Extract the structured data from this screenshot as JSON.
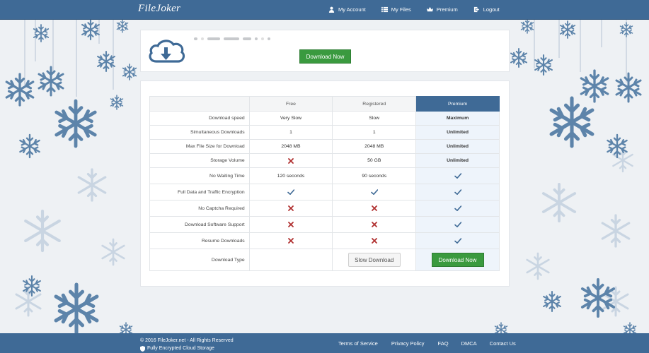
{
  "header": {
    "logo": "FileJoker",
    "nav": [
      {
        "label": "My Account",
        "icon": "user-icon"
      },
      {
        "label": "My Files",
        "icon": "list-icon"
      },
      {
        "label": "Premium",
        "icon": "crown-icon"
      },
      {
        "label": "Logout",
        "icon": "logout-icon"
      }
    ]
  },
  "file": {
    "download_label": "Download Now",
    "icon": "cloud-download-icon"
  },
  "compare": {
    "headers": [
      "",
      "Free",
      "Registered",
      "Premium"
    ],
    "rows": [
      {
        "feature": "Download speed",
        "free": "Very Slow",
        "registered": "Slow",
        "premium": "Maximum"
      },
      {
        "feature": "Simultaneous Downloads",
        "free": "1",
        "registered": "1",
        "premium": "Unlimited"
      },
      {
        "feature": "Max File Size for Download",
        "free": "2048 MB",
        "registered": "2048 MB",
        "premium": "Unlimited"
      },
      {
        "feature": "Storage Volume",
        "free": "cross-icon",
        "registered": "50 GB",
        "premium": "Unlimited"
      },
      {
        "feature": "No Waiting Time",
        "free": "120 seconds",
        "registered": "90 seconds",
        "premium": "check-icon"
      },
      {
        "feature": "Full Data and Traffic Encryption",
        "free": "check-icon",
        "registered": "check-icon",
        "premium": "check-icon"
      },
      {
        "feature": "No Captcha Required",
        "free": "cross-icon",
        "registered": "cross-icon",
        "premium": "check-icon"
      },
      {
        "feature": "Download Software Support",
        "free": "cross-icon",
        "registered": "cross-icon",
        "premium": "check-icon"
      },
      {
        "feature": "Resume Downloads",
        "free": "cross-icon",
        "registered": "cross-icon",
        "premium": "check-icon"
      }
    ],
    "download_type": {
      "feature": "Download Type",
      "slow_label": "Slow Download",
      "premium_label": "Download Now"
    }
  },
  "footer": {
    "copyright": "© 2016 FileJoker.net - All Rights Reserved",
    "encrypted": "Fully Encrypted Cloud Storage",
    "links": [
      "Terms of Service",
      "Privacy Policy",
      "FAQ",
      "DMCA",
      "Contact Us"
    ]
  },
  "colors": {
    "brand_blue": "#3f6a96",
    "button_green": "#3a9a3f",
    "check": "#3f6a96",
    "cross": "#b03030"
  }
}
